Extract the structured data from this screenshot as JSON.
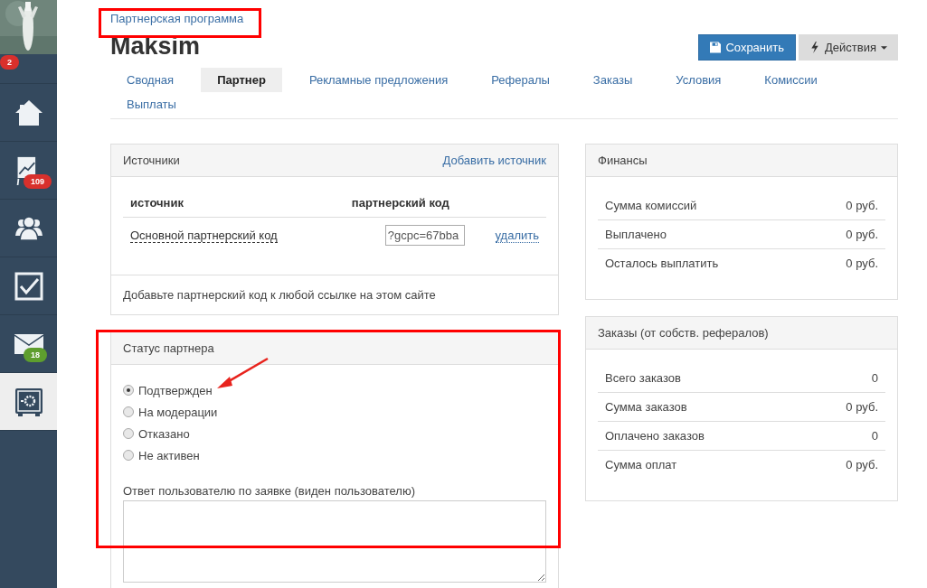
{
  "sidebar": {
    "items": [
      {
        "kind": "avatar",
        "badge": "2",
        "color": "#d9302c",
        "selected": false
      },
      {
        "kind": "home",
        "selected": false
      },
      {
        "kind": "chart",
        "badge": "109",
        "color": "#d9302c",
        "selected": false
      },
      {
        "kind": "people",
        "selected": false
      },
      {
        "kind": "tasks",
        "selected": false
      },
      {
        "kind": "mail",
        "badge": "18",
        "color": "#5e9e2e",
        "selected": false
      },
      {
        "kind": "safe",
        "selected": true
      }
    ]
  },
  "breadcrumb": "Партнерская программа",
  "title": "Maksim",
  "buttons": {
    "save": "Сохранить",
    "actions": "Действия"
  },
  "tabs": [
    {
      "label": "Сводная",
      "selected": false
    },
    {
      "label": "Партнер",
      "selected": true
    },
    {
      "label": "Рекламные предложения",
      "selected": false
    },
    {
      "label": "Рефералы",
      "selected": false
    },
    {
      "label": "Заказы",
      "selected": false
    },
    {
      "label": "Условия",
      "selected": false
    },
    {
      "label": "Комиссии",
      "selected": false
    },
    {
      "label": "Выплаты",
      "selected": false
    }
  ],
  "sources": {
    "title": "Источники",
    "add_link": "Добавить источник",
    "columns": [
      "источник",
      "партнерский код"
    ],
    "rows": [
      {
        "name": "Основной партнерский код",
        "code": "?gcpc=67bba",
        "delete": "удалить"
      }
    ],
    "footer": "Добавьте партнерский код к любой ссылке на этом сайте"
  },
  "status": {
    "title": "Статус партнера",
    "options": [
      {
        "label": "Подтвержден",
        "selected": true
      },
      {
        "label": "На модерации",
        "selected": false
      },
      {
        "label": "Отказано",
        "selected": false
      },
      {
        "label": "Не активен",
        "selected": false
      }
    ],
    "reply_label": "Ответ пользователю по заявке (виден пользователю)"
  },
  "finances": {
    "title": "Финансы",
    "rows": [
      {
        "label": "Сумма комиссий",
        "value": "0 руб."
      },
      {
        "label": "Выплачено",
        "value": "0 руб."
      },
      {
        "label": "Осталось выплатить",
        "value": "0 руб."
      }
    ]
  },
  "orders": {
    "title": "Заказы (от собств. рефералов)",
    "rows": [
      {
        "label": "Всего заказов",
        "value": "0"
      },
      {
        "label": "Сумма заказов",
        "value": "0 руб."
      },
      {
        "label": "Оплачено заказов",
        "value": "0"
      },
      {
        "label": "Сумма оплат",
        "value": "0 руб."
      }
    ]
  }
}
